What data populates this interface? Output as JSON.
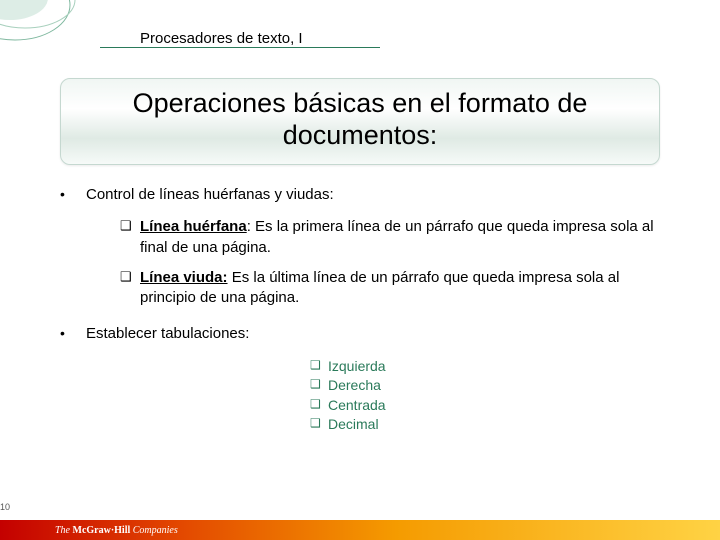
{
  "header": "Procesadores de texto, I",
  "title": "Operaciones básicas en el formato de documentos:",
  "bullet1": "Control de líneas huérfanas y viudas:",
  "sub1_term": "Línea huérfana",
  "sub1_rest": ": Es la primera línea de un párrafo que queda impresa sola al final de una página.",
  "sub2_term": "Línea viuda:",
  "sub2_rest": " Es la última línea de un párrafo que queda impresa sola al principio de una página.",
  "bullet2": "Establecer tabulaciones:",
  "tabs": [
    "Izquierda",
    "Derecha",
    "Centrada",
    "Decimal"
  ],
  "page_number": "10",
  "brand_pre": "The ",
  "brand_bold": "McGraw·Hill",
  "brand_post": " Companies"
}
